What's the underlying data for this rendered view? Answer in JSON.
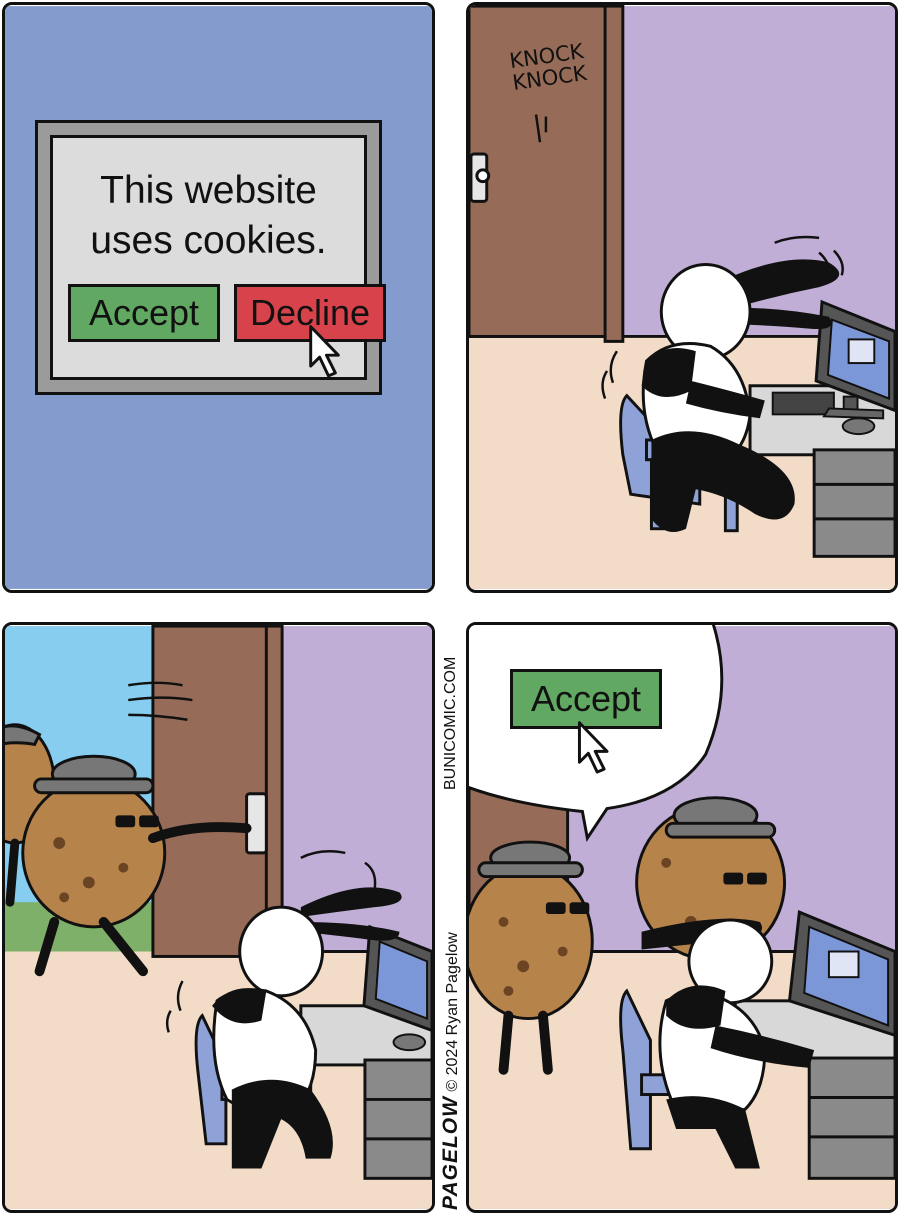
{
  "panel1": {
    "dialog_message": "This website\nuses cookies.",
    "accept_label": "Accept",
    "decline_label": "Decline"
  },
  "panel2": {
    "sound_effect": "KNOCK\nKNOCK"
  },
  "panel4": {
    "speech_button_label": "Accept"
  },
  "credits": {
    "logo": "PAGELOW",
    "copyright": "© 2024 Ryan Pagelow",
    "website": "BUNICOMIC.COM"
  },
  "colors": {
    "accept_green": "#61a862",
    "decline_red": "#d8434b",
    "panel1_background": "#839ccd",
    "wall_lavender": "#c0aed6",
    "floor_beige": "#f2dcc8",
    "door_brown": "#966b57",
    "cookie_brown": "#b6834b",
    "sky_blue": "#87cdf0",
    "chair_blue": "#8fa2d8",
    "desk_gray": "#8a8a8a"
  },
  "icons": [
    "mouse-cursor-icon",
    "mouse-cursor-icon"
  ]
}
